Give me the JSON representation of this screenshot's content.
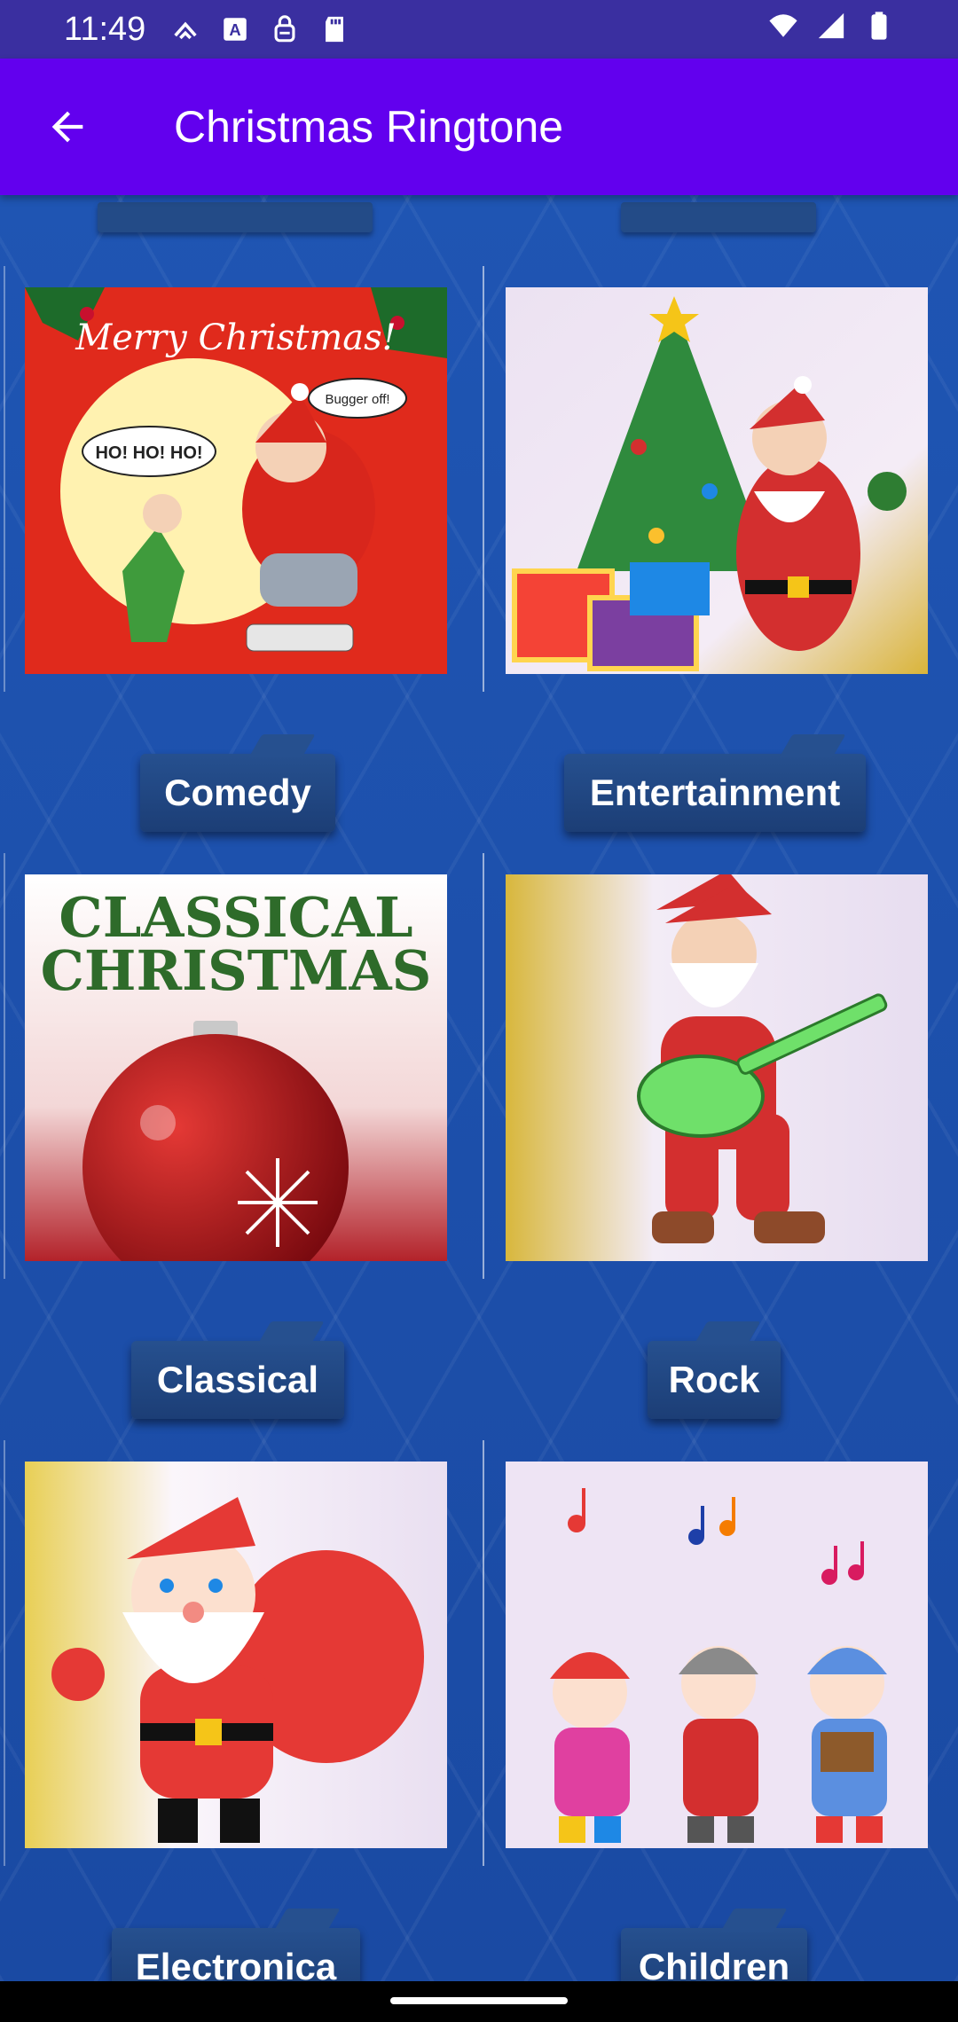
{
  "status_bar": {
    "time": "11:49",
    "left_icons": [
      "cast-icon",
      "a-icon",
      "vpn-icon",
      "sd-card-icon"
    ],
    "right_icons": [
      "wifi-icon",
      "signal-icon",
      "battery-icon"
    ]
  },
  "app_bar": {
    "back_icon": "arrow-left-icon",
    "title": "Christmas Ringtone",
    "background": "#6200ee"
  },
  "categories": [
    {
      "label": "Comedy",
      "image": "merry-christmas-santa-weighing-scale"
    },
    {
      "label": "Entertainment",
      "image": "santa-christmas-tree-gifts"
    },
    {
      "label": "Classical",
      "image": "classical-christmas-ornament"
    },
    {
      "label": "Rock",
      "image": "santa-electric-guitar"
    },
    {
      "label": "Electronica",
      "image": "santa-waving-with-sack"
    },
    {
      "label": "Children",
      "image": "children-singing-carols"
    }
  ],
  "comedy_thumb": {
    "headline": "Merry Christmas!",
    "speech_left": "HO! HO! HO!",
    "speech_right": "Bugger off!"
  },
  "classical_thumb": {
    "line1": "CLASSICAL",
    "line2": "CHRISTMAS"
  },
  "colors": {
    "status_bar": "#3a2fa0",
    "background": "#1d4fa8",
    "label_plate": "#234b87"
  }
}
